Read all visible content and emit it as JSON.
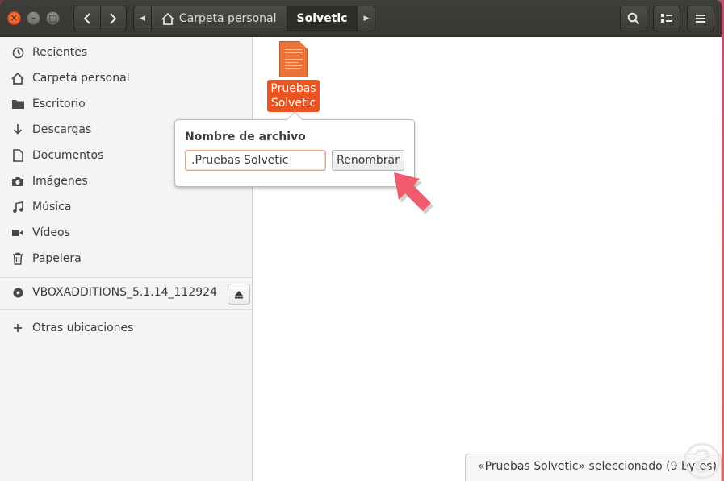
{
  "window": {
    "controls": [
      "close",
      "minimize",
      "maximize"
    ]
  },
  "nav": {
    "back_icon": "chevron-left-icon",
    "forward_icon": "chevron-right-icon"
  },
  "pathbar": {
    "home_label": "Carpeta personal",
    "current_label": "Solvetic"
  },
  "header_buttons": [
    "search-icon",
    "view-options-icon",
    "hamburger-menu-icon"
  ],
  "sidebar": {
    "items": [
      {
        "label": "Recientes",
        "icon": "clock-icon"
      },
      {
        "label": "Carpeta personal",
        "icon": "home-icon"
      },
      {
        "label": "Escritorio",
        "icon": "folder-icon"
      },
      {
        "label": "Descargas",
        "icon": "download-icon"
      },
      {
        "label": "Documentos",
        "icon": "document-icon"
      },
      {
        "label": "Imágenes",
        "icon": "camera-icon"
      },
      {
        "label": "Música",
        "icon": "music-icon"
      },
      {
        "label": "Vídeos",
        "icon": "video-icon"
      },
      {
        "label": "Papelera",
        "icon": "trash-icon"
      }
    ],
    "device": {
      "label": "VBOXADDITIONS_5.1.14_112924",
      "icon": "disc-icon"
    },
    "other_locations": {
      "label": "Otras ubicaciones",
      "icon": "plus-icon"
    }
  },
  "file": {
    "name_line1": "Pruebas",
    "name_line2": "Solvetic"
  },
  "rename_popover": {
    "title": "Nombre de archivo",
    "value": ".Pruebas Solvetic",
    "button_label": "Renombrar"
  },
  "status": {
    "text": "«Pruebas Solvetic» seleccionado  (9 bytes)"
  },
  "colors": {
    "accent": "#e95420",
    "header": "#3c3b37",
    "pointer": "#f25b6e"
  }
}
